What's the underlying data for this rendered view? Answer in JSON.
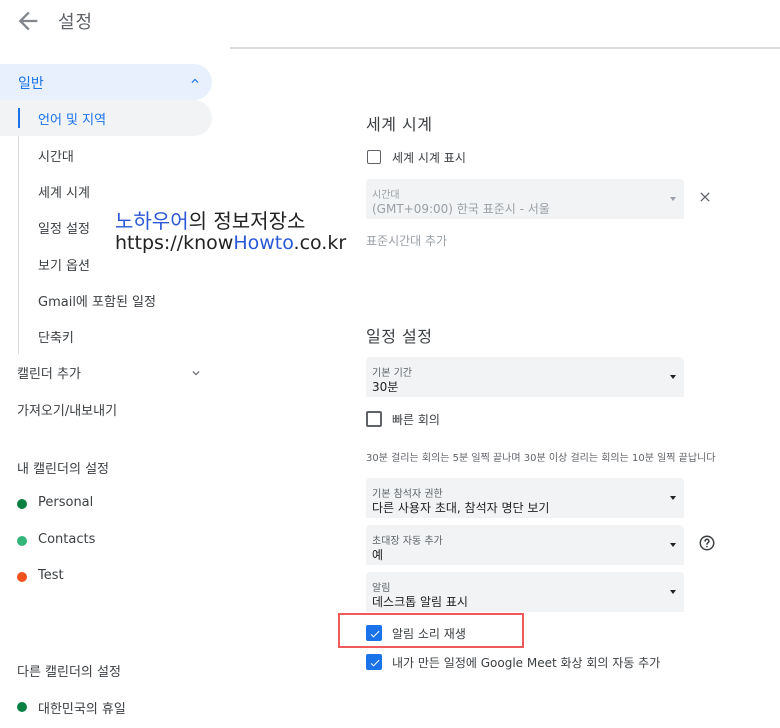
{
  "header": {
    "title": "설정"
  },
  "sidebar": {
    "general": "일반",
    "sub_items": [
      "언어 및 지역",
      "시간대",
      "세계 시계",
      "일정 설정",
      "보기 옵션",
      "Gmail에 포함된 일정",
      "단축키"
    ],
    "add_calendar": "캘린더 추가",
    "import_export": "가져오기/내보내기",
    "my_calendars_title": "내 캘린더의 설정",
    "my_calendars": [
      {
        "name": "Personal",
        "color": "#0b8043"
      },
      {
        "name": "Contacts",
        "color": "#33b679"
      },
      {
        "name": "Test",
        "color": "#f4511e"
      }
    ],
    "other_calendars_title": "다른 캘린더의 설정",
    "other_calendars": [
      {
        "name": "대한민국의 휴일",
        "color": "#0b8043"
      }
    ]
  },
  "watermark": {
    "line1_blue": "노하우어",
    "line1_rest": "의 정보저장소",
    "line2_a": "https://know",
    "line2_blue": "Howto",
    "line2_b": ".co.kr"
  },
  "world_clock": {
    "title": "세계 시계",
    "show_label": "세계 시계 표시",
    "timezone_label": "시간대",
    "timezone_value": "(GMT+09:00) 한국 표준시 - 서울",
    "add_timezone": "표준시간대 추가"
  },
  "event_settings": {
    "title": "일정 설정",
    "duration_label": "기본 기간",
    "duration_value": "30분",
    "speedy_meetings": "빠른 회의",
    "speedy_note": "30분 걸리는 회의는 5분 일찍 끝나며 30분 이상 걸리는 회의는 10분 일찍 끝납니다",
    "guest_perm_label": "기본 참석자 권한",
    "guest_perm_value": "다른 사용자 초대, 참석자 명단 보기",
    "auto_add_label": "초대장 자동 추가",
    "auto_add_value": "예",
    "notif_label": "알림",
    "notif_value": "데스크톱 알림 표시",
    "play_sounds": "알림 소리 재생",
    "auto_meet": "내가 만든 일정에 Google Meet 화상 회의 자동 추가"
  },
  "colors": {
    "accent": "#1a73e8",
    "highlight_box": "#f05a5a"
  }
}
